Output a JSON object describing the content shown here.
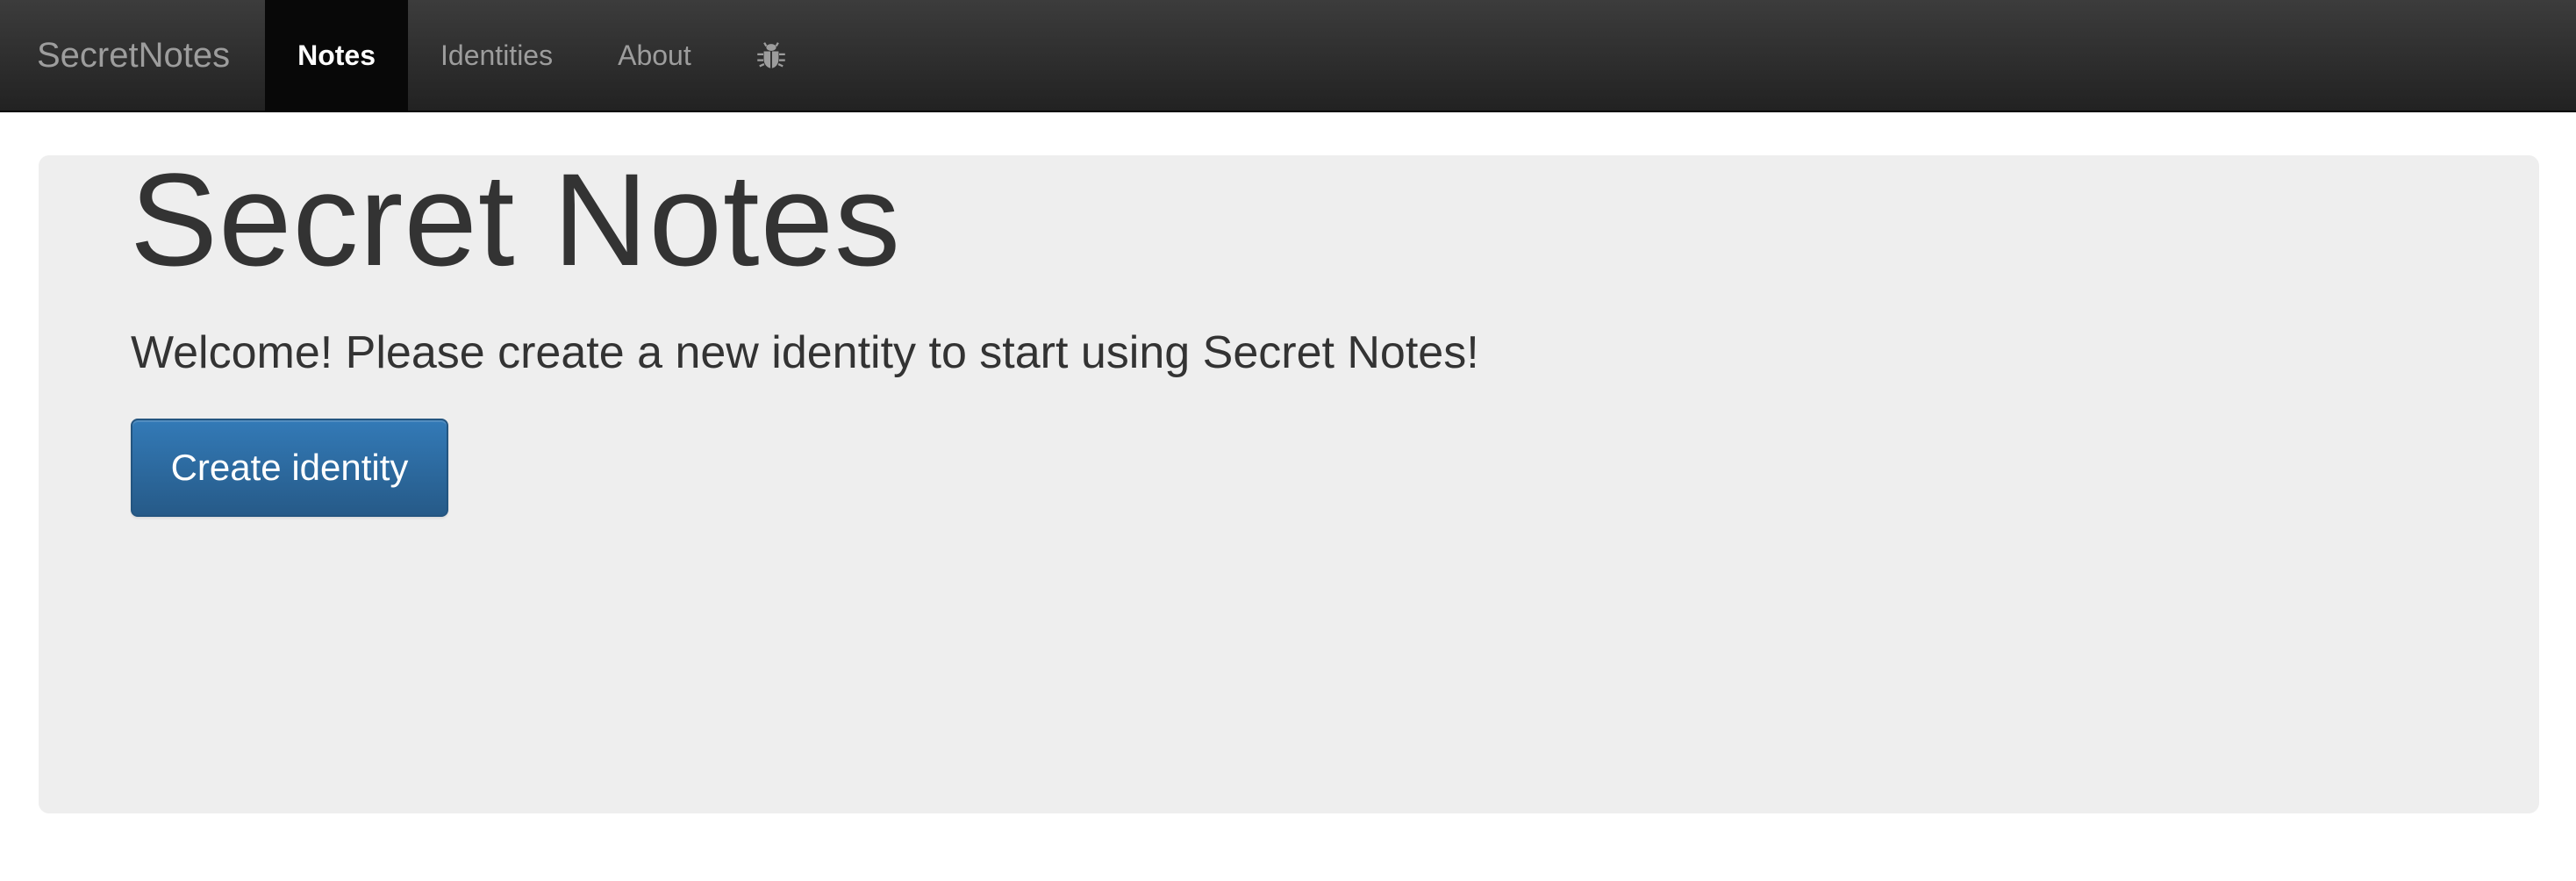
{
  "navbar": {
    "brand": "SecretNotes",
    "items": [
      {
        "label": "Notes",
        "active": true
      },
      {
        "label": "Identities",
        "active": false
      },
      {
        "label": "About",
        "active": false
      }
    ],
    "bug_icon": "bug-icon"
  },
  "jumbotron": {
    "title": "Secret Notes",
    "lead": "Welcome! Please create a new identity to start using Secret Notes!",
    "button_label": "Create identity"
  },
  "colors": {
    "navbar_bg": "#222222",
    "active_tab_bg": "#080808",
    "jumbotron_bg": "#eeeeee",
    "primary_button": "#337ab7"
  }
}
